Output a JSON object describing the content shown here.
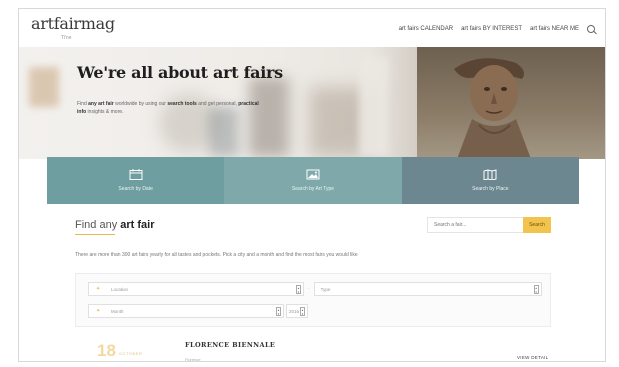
{
  "header": {
    "logo": "artfairmag",
    "logo_sub": "Ti'ne",
    "nav": [
      "art fairs CALENDAR",
      "art fairs BY INTEREST",
      "art fairs NEAR ME"
    ]
  },
  "hero": {
    "title": "We're all about art fairs",
    "text_1": "Find ",
    "text_bold_1": "any art fair",
    "text_2": " worldwide by using our ",
    "text_bold_2": "search tools",
    "text_3": " and get personal, ",
    "text_bold_3": "practical info",
    "text_4": " insights & more."
  },
  "search_by": [
    {
      "label": "Search by Date",
      "icon": "calendar-icon"
    },
    {
      "label": "Search by Art Type",
      "icon": "image-icon"
    },
    {
      "label": "Search by Place",
      "icon": "map-icon"
    }
  ],
  "find": {
    "title_light": "Find any ",
    "title_bold": "art fair",
    "search_placeholder": "Search a fair...",
    "search_button": "Search",
    "description": "There are more than 300 art fairs yearly for all tastes and pockets. Pick a city and a month and find the most fairs you would like"
  },
  "filters": {
    "location_label": "Location",
    "type_label": "Type",
    "month_label": "Month",
    "year_label": "2016"
  },
  "event": {
    "day": "18",
    "month": "OCTOBER",
    "title": "FLORENCE BIENNALE",
    "subtitle": "Florence",
    "link": "VIEW DETAIL"
  },
  "colors": {
    "accent": "#f2c44d",
    "bar_1": "#6e9ea0",
    "bar_2": "#7ea8aa",
    "bar_3": "#6c8790"
  }
}
